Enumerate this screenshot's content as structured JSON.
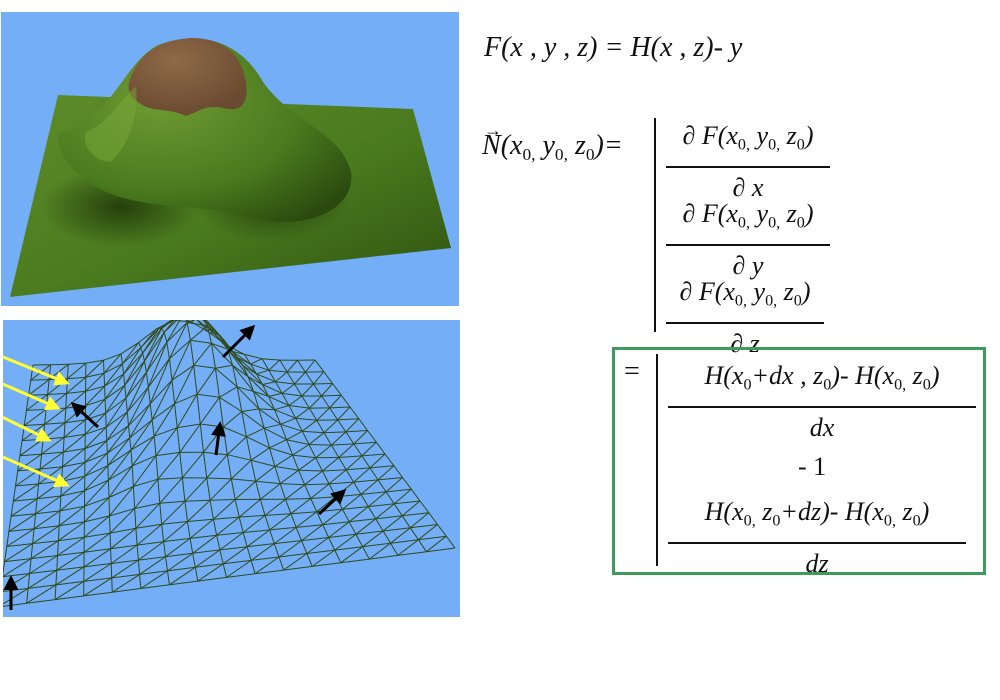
{
  "equation_F": {
    "lhs": "F(x , y , z)",
    "rhs": "= H(x , z)- y"
  },
  "normal": {
    "lhs_symbol": "N",
    "lhs_args": "(x",
    "lhs_sub0": "0,",
    "lhs_y": " y",
    "lhs_z": " z",
    "lhs_close": ")=",
    "row1_num": "∂ F(x0, y0, z0)",
    "row1_den": "∂ x",
    "row2_num": "∂ F(x0, y0, z0)",
    "row2_den": "∂ y",
    "row3_num": "∂ F(x0, y0, z0)",
    "row3_den": "∂ z"
  },
  "result": {
    "equals": "=",
    "row1_num": "H(x0+dx , z0)- H(x0, z0)",
    "row1_den": "dx",
    "row2": "- 1",
    "row3_num": "H(x0, z0+dz)- H(x0, z0)",
    "row3_den": "dz"
  },
  "colors": {
    "sky": "#74aef6",
    "grass": "#4a7a1e",
    "rock": "#7e5a3e",
    "wire": "#2f4a1c",
    "light_arrow": "#ffff33",
    "normal_arrow": "#000000",
    "highlight_box": "#3f9b5d"
  }
}
